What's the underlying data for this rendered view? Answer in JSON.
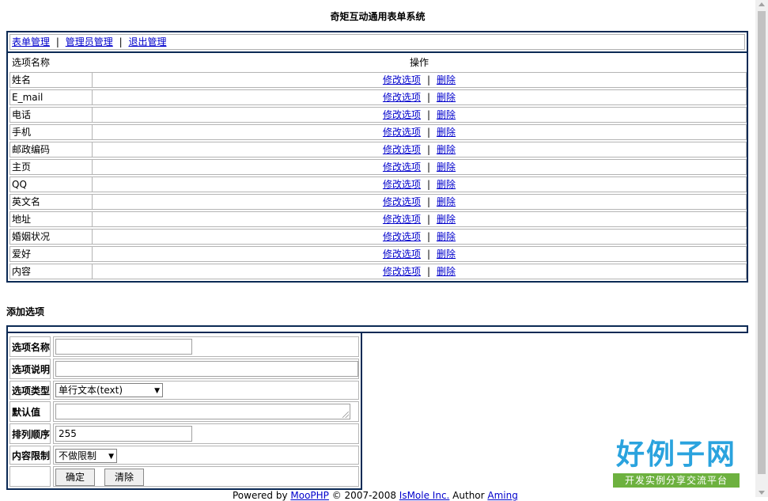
{
  "title": "奇矩互动通用表单系统",
  "nav": {
    "form_manage": "表单管理",
    "sep1": "|",
    "admin_manage": "管理员管理",
    "sep2": "|",
    "logout_manage": "退出管理"
  },
  "list": {
    "col_name": "选项名称",
    "col_ops": "操作",
    "rows": [
      {
        "name": "姓名",
        "edit": "修改选项",
        "sep": "|",
        "delete": "删除"
      },
      {
        "name": "E_mail",
        "edit": "修改选项",
        "sep": "|",
        "delete": "删除"
      },
      {
        "name": "电话",
        "edit": "修改选项",
        "sep": "|",
        "delete": "删除"
      },
      {
        "name": "手机",
        "edit": "修改选项",
        "sep": "|",
        "delete": "删除"
      },
      {
        "name": "邮政编码",
        "edit": "修改选项",
        "sep": "|",
        "delete": "删除"
      },
      {
        "name": "主页",
        "edit": "修改选项",
        "sep": "|",
        "delete": "删除"
      },
      {
        "name": "QQ",
        "edit": "修改选项",
        "sep": "|",
        "delete": "删除"
      },
      {
        "name": "英文名",
        "edit": "修改选项",
        "sep": "|",
        "delete": "删除"
      },
      {
        "name": "地址",
        "edit": "修改选项",
        "sep": "|",
        "delete": "删除"
      },
      {
        "name": "婚姻状况",
        "edit": "修改选项",
        "sep": "|",
        "delete": "删除"
      },
      {
        "name": "爱好",
        "edit": "修改选项",
        "sep": "|",
        "delete": "删除"
      },
      {
        "name": "内容",
        "edit": "修改选项",
        "sep": "|",
        "delete": "删除"
      }
    ]
  },
  "add": {
    "title": "添加选项",
    "name_label": "选项名称",
    "name_value": "",
    "desc_label": "选项说明",
    "desc_value": "",
    "type_label": "选项类型",
    "type_selected": "单行文本(text)",
    "default_label": "默认值",
    "default_value": "",
    "order_label": "排列顺序",
    "order_value": "255",
    "limit_label": "内容限制",
    "limit_selected": "不做限制",
    "submit_label": "确定",
    "reset_label": "清除"
  },
  "footer": {
    "powered": "Powered by ",
    "product": "MooPHP",
    "copyright": " © 2007-2008 ",
    "company": "IsMole Inc.",
    "author_label": " Author ",
    "author": "Aming"
  },
  "watermark": {
    "big": "好例子网",
    "small": "开发实例分享交流平台"
  },
  "colors": {
    "border": "#0b2a55",
    "link": "#0000cc",
    "logo_blue": "#2aa3de",
    "logo_green": "#6db13f"
  }
}
